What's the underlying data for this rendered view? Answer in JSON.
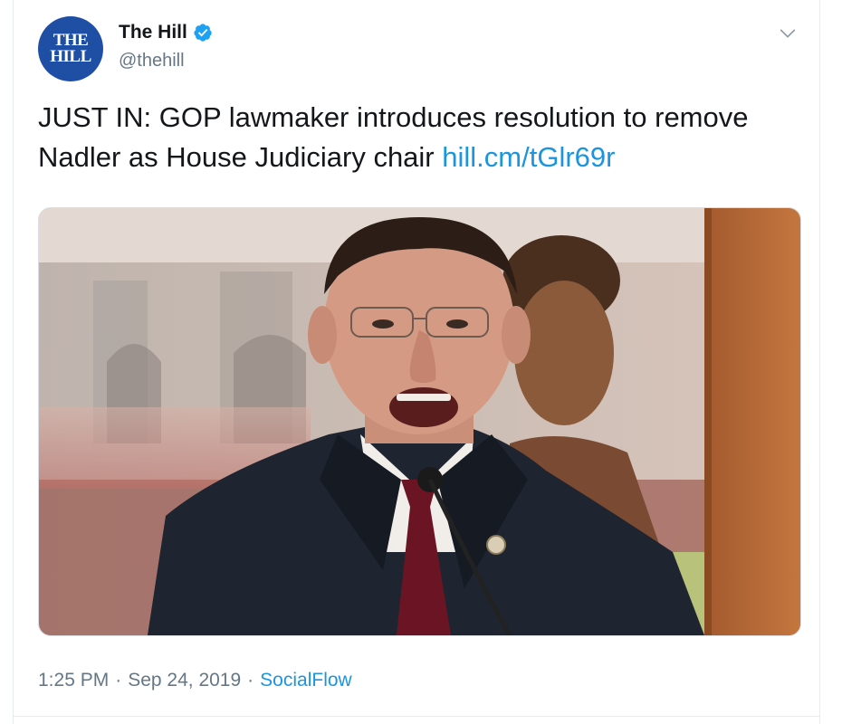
{
  "account": {
    "avatar_line1": "THE",
    "avatar_line2": "HILL",
    "name": "The Hill",
    "handle": "@thehill",
    "verified_icon": "verified-badge-icon"
  },
  "tweet": {
    "text": "JUST IN: GOP lawmaker introduces resolution to remove Nadler as House Judiciary chair",
    "link": "hill.cm/tGlr69r"
  },
  "meta": {
    "time": "1:25 PM",
    "sep1": "·",
    "date": "Sep 24, 2019",
    "sep2": "·",
    "source": "SocialFlow"
  },
  "colors": {
    "link": "#1b95e0",
    "avatar_bg": "#1f4fa5",
    "muted": "#657786"
  }
}
